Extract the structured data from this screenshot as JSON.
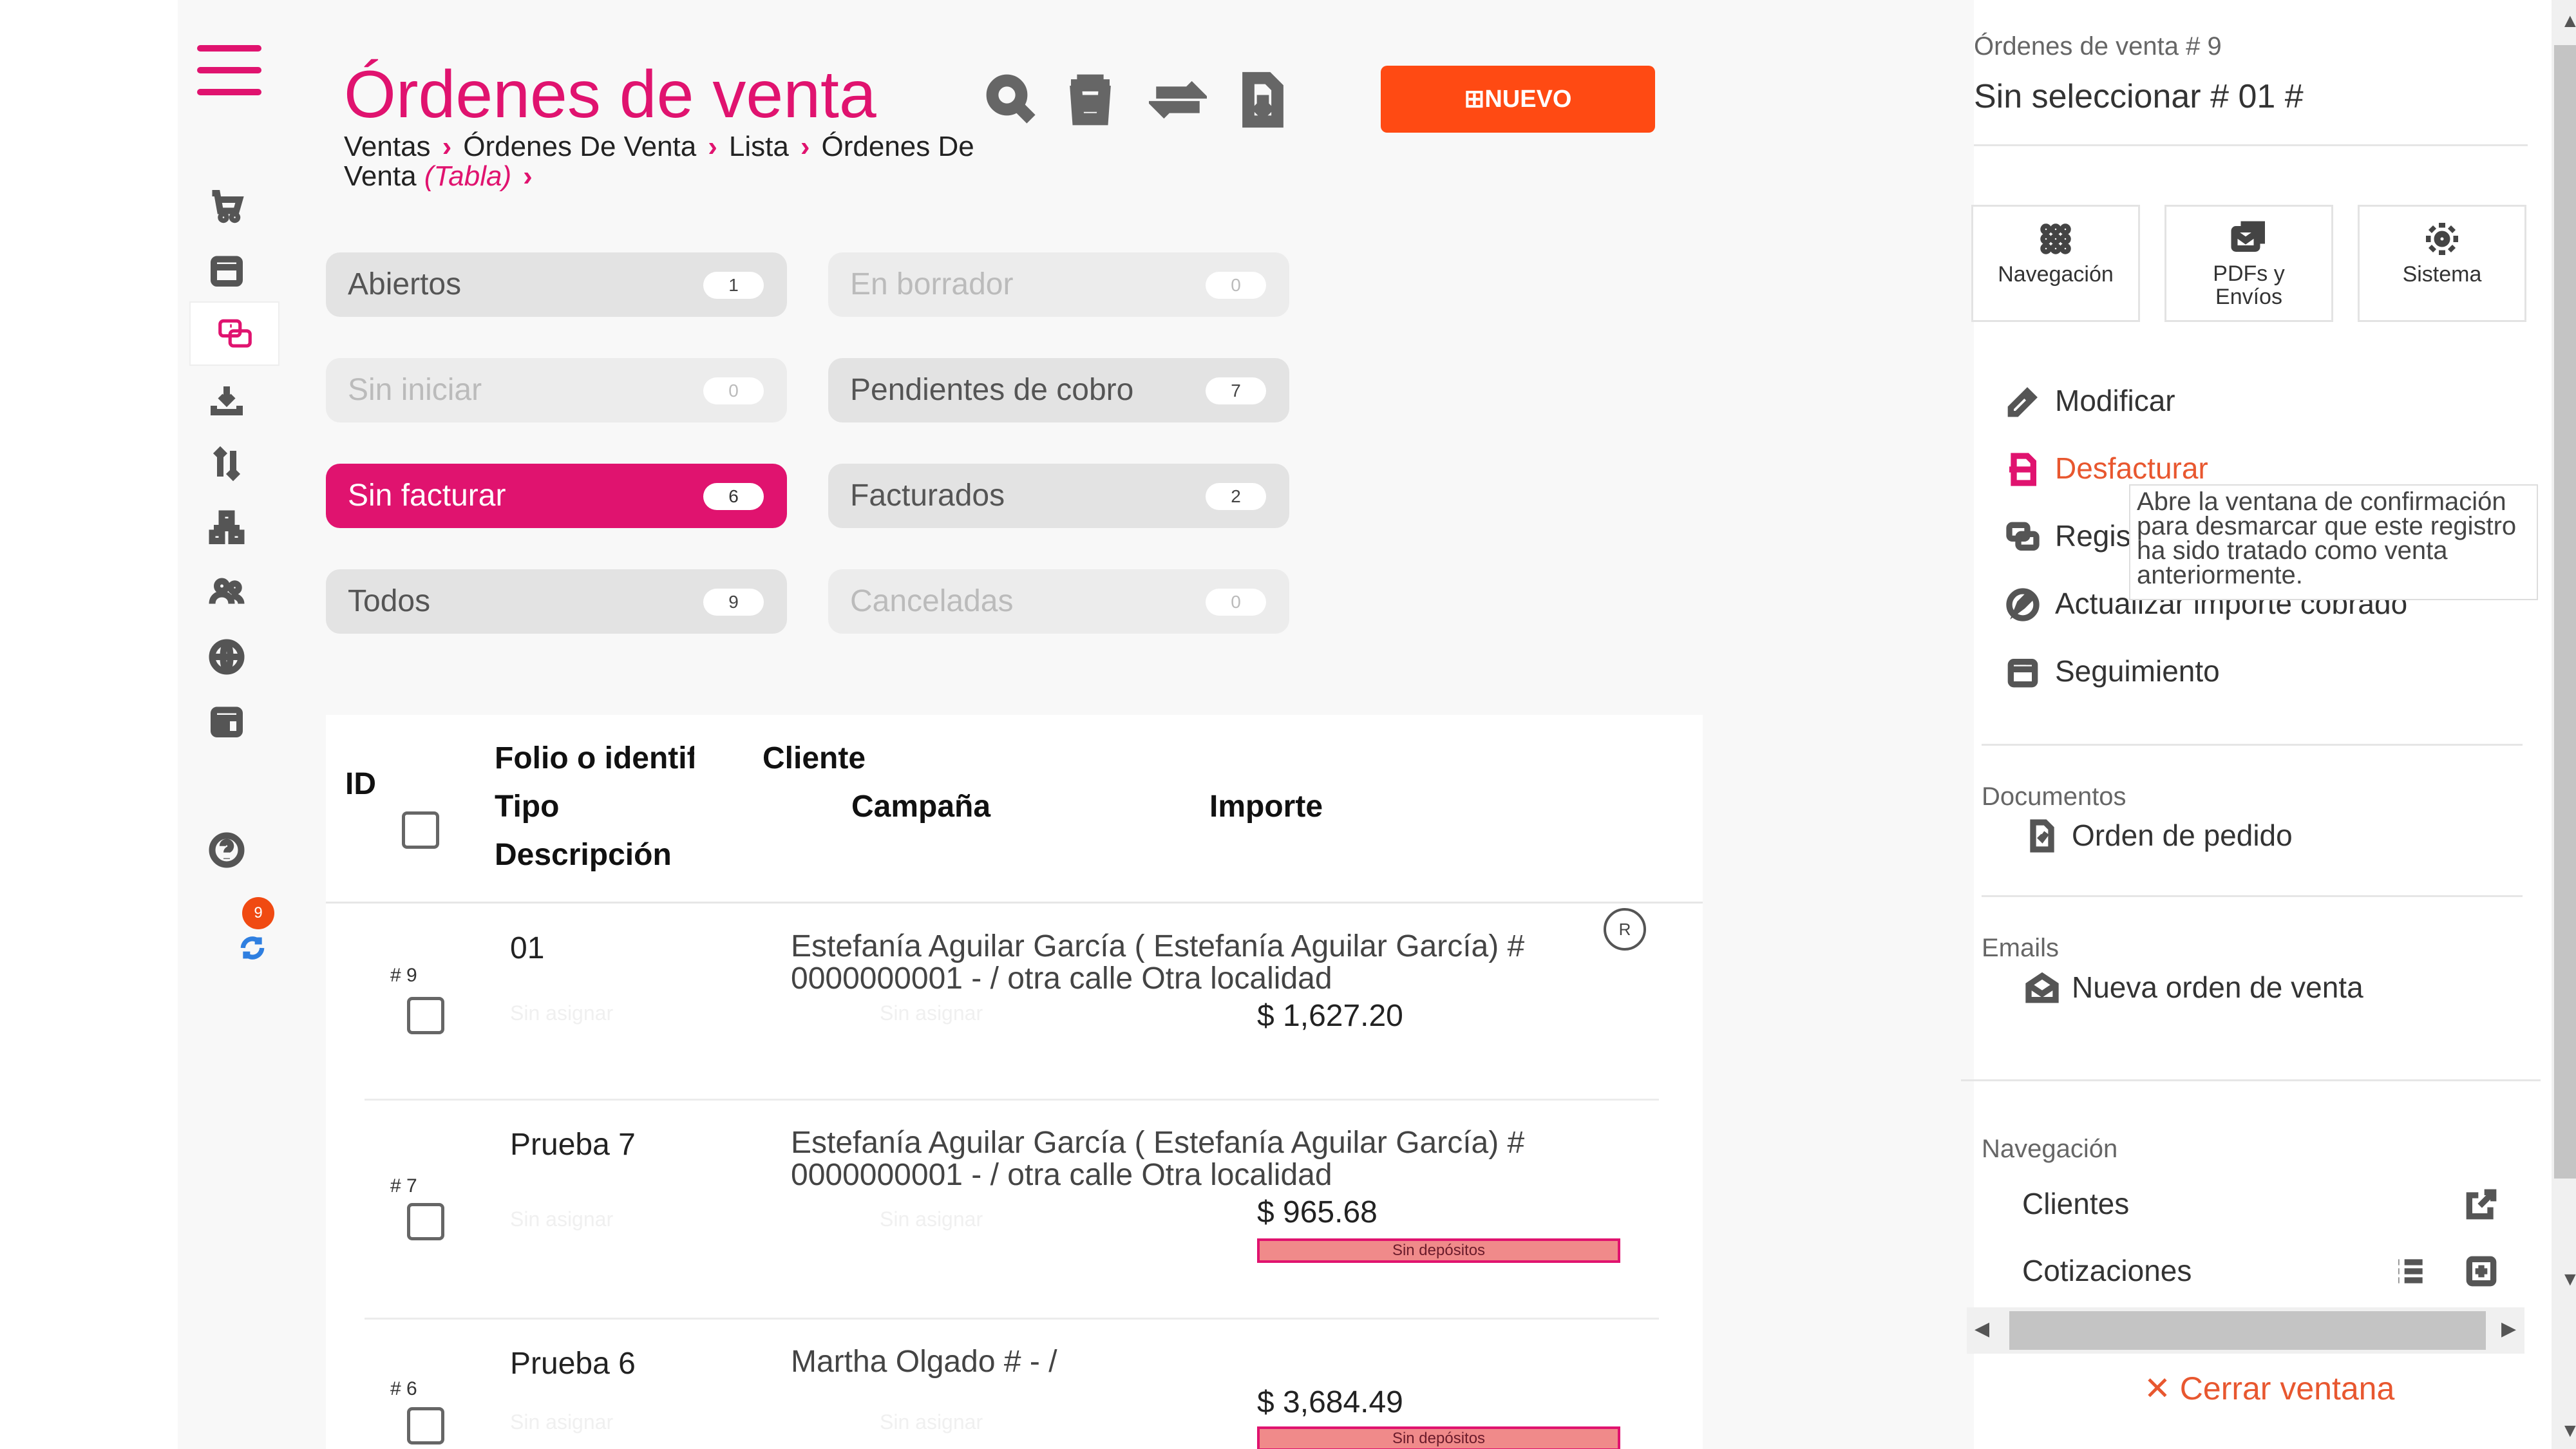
{
  "header": {
    "title": "Órdenes de venta",
    "breadcrumb": [
      "Ventas",
      "Órdenes De Venta",
      "Lista",
      "Órdenes De Venta"
    ],
    "breadcrumb_view": "(Tabla)",
    "new_button": "NUEVO"
  },
  "filters": [
    {
      "label": "Abiertos",
      "count": "1"
    },
    {
      "label": "En borrador",
      "count": "0"
    },
    {
      "label": "Sin iniciar",
      "count": "0"
    },
    {
      "label": "Pendientes de cobro",
      "count": "7"
    },
    {
      "label": "Sin facturar",
      "count": "6"
    },
    {
      "label": "Facturados",
      "count": "2"
    },
    {
      "label": "Todos",
      "count": "9"
    },
    {
      "label": "Canceladas",
      "count": "0"
    }
  ],
  "table": {
    "headers": {
      "id": "ID",
      "folio": "Folio o identificador",
      "tipo": "Tipo",
      "descripcion": "Descripción",
      "cliente": "Cliente",
      "campana": "Campaña",
      "importe": "Importe"
    },
    "unassigned": "Sin asignar",
    "rows": [
      {
        "id": "# 9",
        "folio": "01",
        "client": "Estefanía Aguilar García ( Estefanía Aguilar García) # 0000000001 - / otra calle Otra localidad",
        "amount": "$ 1,627.20",
        "badge": "R"
      },
      {
        "id": "# 7",
        "folio": "Prueba 7",
        "client": "Estefanía Aguilar García ( Estefanía Aguilar García) # 0000000001 - / otra calle Otra localidad",
        "amount": "$ 965.68",
        "deposit": "Sin depósitos"
      },
      {
        "id": "# 6",
        "folio": "Prueba 6",
        "client": "Martha Olgado # - /",
        "amount": "$ 3,684.49",
        "deposit": "Sin depósitos"
      }
    ]
  },
  "panel": {
    "subtitle": "Órdenes de venta # 9",
    "title": "Sin seleccionar # 01 #",
    "tiles": [
      "Navegación",
      "PDFs y Envíos",
      "Sistema"
    ],
    "actions": [
      "Modificar",
      "Desfacturar",
      "Registrar",
      "Actualizar importe cobrado",
      "Seguimiento"
    ],
    "tooltip": "Abre la ventana de confirmación para desmarcar que este registro ha sido tratado como venta anteriormente.",
    "documents_label": "Documentos",
    "documents": [
      "Orden de pedido"
    ],
    "emails_label": "Emails",
    "emails": [
      "Nueva orden de venta"
    ],
    "nav_label": "Navegación",
    "nav_items": [
      "Clientes",
      "Cotizaciones"
    ],
    "close": "✕ Cerrar ventana"
  },
  "rail": {
    "sync_badge": "9"
  },
  "colors": {
    "brand": "#e0136f",
    "accent": "#ff4a13"
  }
}
